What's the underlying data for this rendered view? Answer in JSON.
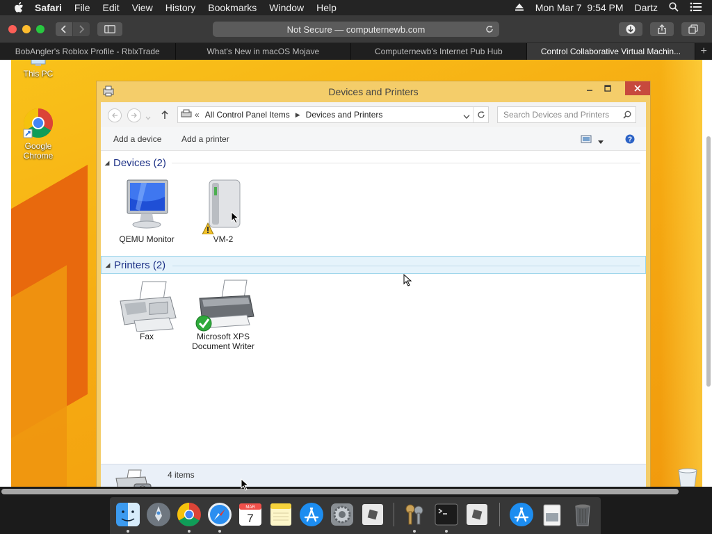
{
  "menubar": {
    "app": "Safari",
    "items": [
      "File",
      "Edit",
      "View",
      "History",
      "Bookmarks",
      "Window",
      "Help"
    ],
    "datetime": "Mon Mar 7  9:54 PM",
    "user": "Dartz"
  },
  "safari": {
    "url": "Not Secure — computernewb.com",
    "tabs": [
      "BobAngler's Roblox Profile - RblxTrade",
      "What's New in macOS Mojave",
      "Computernewb's Internet Pub Hub",
      "Control Collaborative Virtual Machin..."
    ],
    "new_tab": "+"
  },
  "desktop": {
    "icons": [
      "This PC",
      "Google Chrome"
    ]
  },
  "window": {
    "title": "Devices and Printers",
    "breadcrumb_prefix": "«",
    "breadcrumb": [
      "All Control Panel Items",
      "Devices and Printers"
    ],
    "search_placeholder": "Search Devices and Printers",
    "commands": [
      "Add a device",
      "Add a printer"
    ],
    "groups": {
      "devices": {
        "label": "Devices (2)",
        "items": [
          "QEMU Monitor",
          "VM-2"
        ]
      },
      "printers": {
        "label": "Printers (2)",
        "items": [
          "Fax",
          "Microsoft XPS Document Writer"
        ]
      }
    },
    "status": "4 items"
  },
  "dock": {
    "apps": [
      "Finder",
      "Launchpad",
      "Google Chrome",
      "Safari",
      "Calendar",
      "Notes",
      "App Store",
      "System Preferences",
      "Roblox",
      "Keychain Access",
      "Terminal",
      "Roblox Studio",
      "App Store",
      "Documents",
      "Trash"
    ],
    "calendar_day": "7",
    "calendar_month": "MAR"
  }
}
